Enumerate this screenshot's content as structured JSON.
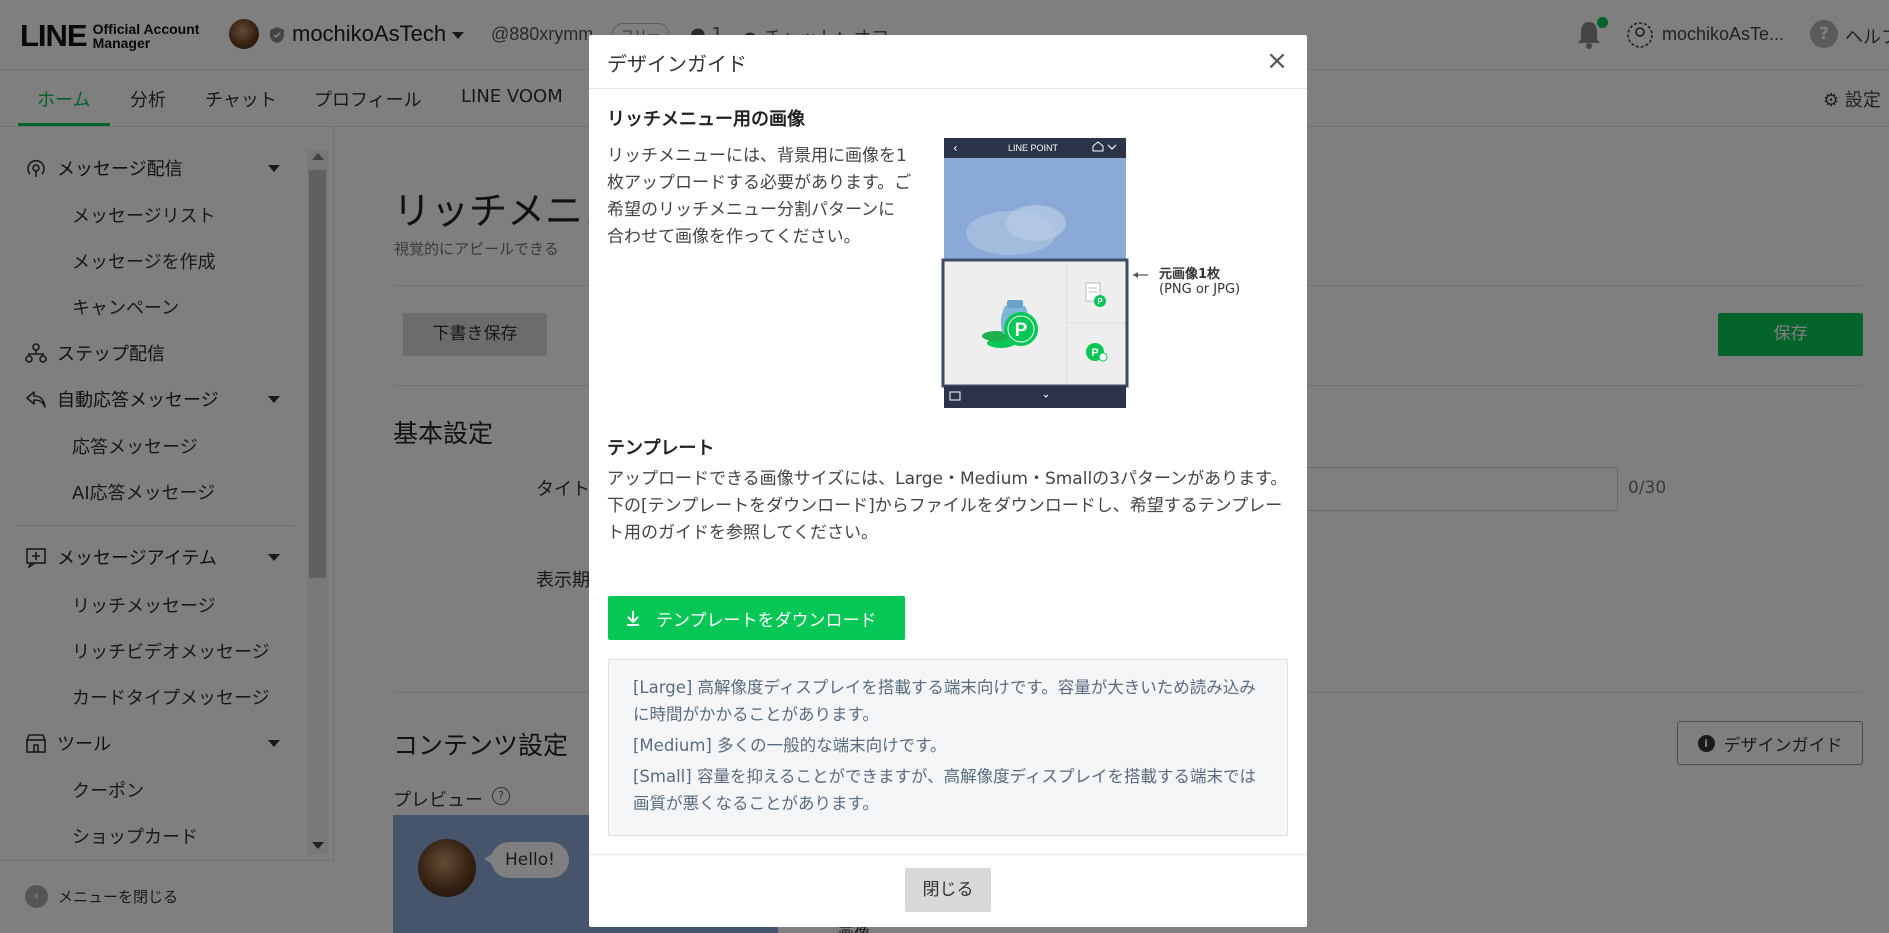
{
  "header": {
    "logo_main": "LINE",
    "logo_sub_line1": "Official Account",
    "logo_sub_line2": "Manager",
    "account_name": "mochikoAsTech",
    "account_id": "@880xrymm",
    "plan_badge": "フリー",
    "friends_count": "1",
    "chat_status": "チャット：オフ",
    "user_name": "mochikoAsTe...",
    "help_label": "ヘルプ",
    "notification_dot_color": "#06c755"
  },
  "nav": {
    "tabs": [
      {
        "label": "ホーム",
        "active": true
      },
      {
        "label": "分析",
        "active": false
      },
      {
        "label": "チャット",
        "active": false
      },
      {
        "label": "プロフィール",
        "active": false
      },
      {
        "label": "LINE VOOM",
        "active": false
      }
    ],
    "settings_label": "設定"
  },
  "sidebar": {
    "sections": [
      {
        "label": "メッセージ配信",
        "icon": "broadcast-icon",
        "items": [
          "メッセージリスト",
          "メッセージを作成",
          "キャンペーン"
        ]
      },
      {
        "label": "ステップ配信",
        "icon": "step-icon",
        "items": []
      },
      {
        "label": "自動応答メッセージ",
        "icon": "reply-icon",
        "items": [
          "応答メッセージ",
          "AI応答メッセージ"
        ]
      },
      {
        "label": "メッセージアイテム",
        "icon": "message-item-icon",
        "items": [
          "リッチメッセージ",
          "リッチビデオメッセージ",
          "カードタイプメッセージ"
        ]
      },
      {
        "label": "ツール",
        "icon": "tool-icon",
        "items": [
          "クーポン",
          "ショップカード"
        ]
      }
    ],
    "close_menu": "メニューを閉じる"
  },
  "main": {
    "page_title": "リッチメニュー",
    "page_subtitle": "視覚的にアピールできる",
    "draft_button": "下書き保存",
    "save_button": "保存",
    "basic_settings": "基本設定",
    "title_label": "タイトル",
    "title_counter": "0/30",
    "period_label": "表示期間",
    "content_settings": "コンテンツ設定",
    "design_guide_button": "デザインガイド",
    "preview_label": "プレビュー",
    "preview_help": "?",
    "preview_message": "Hello!",
    "bottom_label": "画像"
  },
  "modal": {
    "title": "デザインガイド",
    "close_icon": "×",
    "section1_heading": "リッチメニュー用の画像",
    "section1_text": "リッチメニューには、背景用に画像を1枚アップロードする必要があります。ご希望のリッチメニュー分割パターンに合わせて画像を作ってください。",
    "figure_header": "LINE POINT",
    "figure_note_title": "元画像1枚",
    "figure_note_sub": "(PNG or JPG)",
    "section2_heading": "テンプレート",
    "section2_text_1": "アップロードできる画像サイズには、Large・Medium・Smallの3パターンがあります。",
    "section2_text_2": "下の[テンプレートをダウンロード]からファイルをダウンロードし、希望するテンプレート用のガイドを参照してください。",
    "download_button": "テンプレートをダウンロード",
    "size_notes": [
      "[Large] 高解像度ディスプレイを搭載する端末向けです。容量が大きいため読み込みに時間がかかることがあります。",
      "[Medium] 多くの一般的な端末向けです。",
      "[Small] 容量を抑えることができますが、高解像度ディスプレイを搭載する端末では画質が悪くなることがあります。"
    ],
    "close_button": "閉じる"
  },
  "colors": {
    "brand_green": "#06c755",
    "overlay": "rgba(0,0,0,0.5)"
  }
}
